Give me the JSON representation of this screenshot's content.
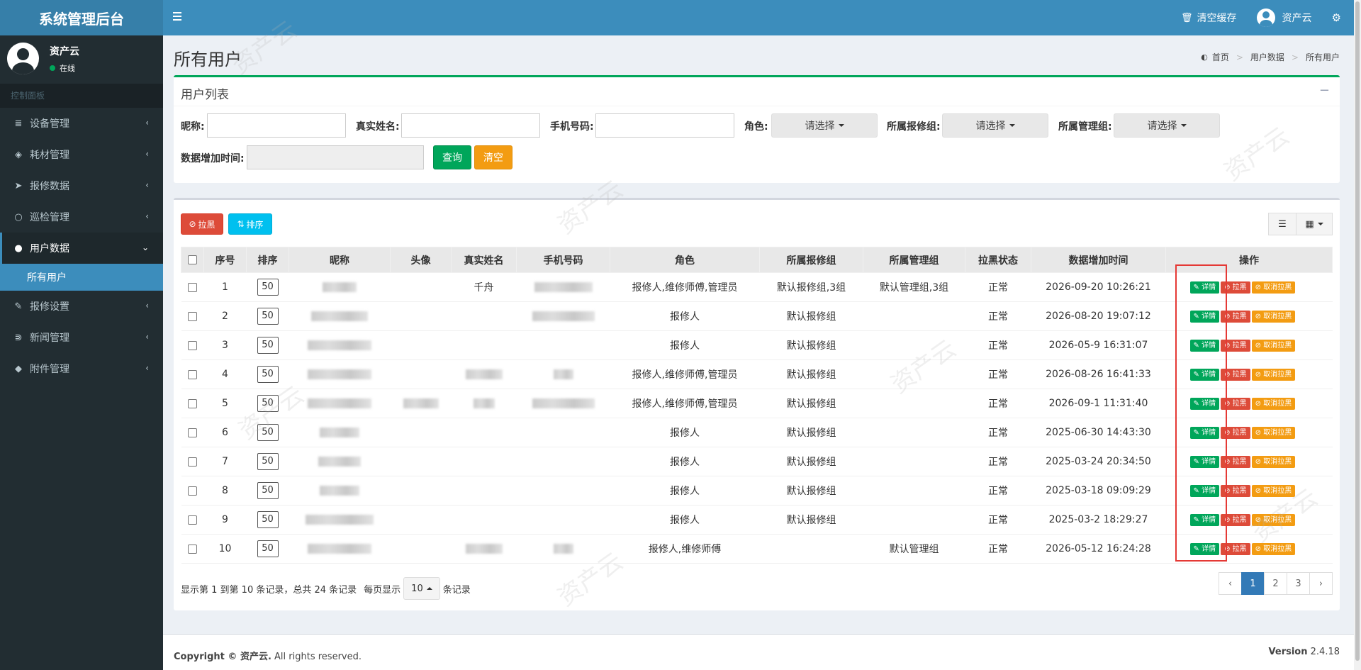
{
  "header": {
    "logo": "系统管理后台",
    "clear_cache": "清空缓存",
    "user": "资产云"
  },
  "sidebar": {
    "user": "资产云",
    "status": "在线",
    "section": "控制面板",
    "items": [
      {
        "label": "设备管理",
        "icon": "database-icon"
      },
      {
        "label": "耗材管理",
        "icon": "cube-icon"
      },
      {
        "label": "报修数据",
        "icon": "paper-plane-icon"
      },
      {
        "label": "巡检管理",
        "icon": "circle-icon"
      },
      {
        "label": "用户数据",
        "icon": "user-icon"
      },
      {
        "label": "报修设置",
        "icon": "wrench-icon"
      },
      {
        "label": "新闻管理",
        "icon": "rss-icon"
      },
      {
        "label": "附件管理",
        "icon": "tag-icon"
      }
    ],
    "sub_item": "所有用户"
  },
  "page": {
    "title": "所有用户",
    "breadcrumb": [
      "首页",
      "用户数据",
      "所有用户"
    ]
  },
  "search": {
    "title": "用户列表",
    "nickname_label": "昵称:",
    "realname_label": "真实姓名:",
    "phone_label": "手机号码:",
    "role_label": "角色:",
    "repair_group_label": "所属报修组:",
    "manage_group_label": "所属管理组:",
    "select_placeholder": "请选择",
    "date_label": "数据增加时间:",
    "query_button": "查询",
    "clear_button": "清空"
  },
  "toolbar": {
    "blacklist": "拉黑",
    "sort": "排序"
  },
  "table": {
    "headers": [
      "序号",
      "排序",
      "昵称",
      "头像",
      "真实姓名",
      "手机号码",
      "角色",
      "所属报修组",
      "所属管理组",
      "拉黑状态",
      "数据增加时间",
      "操作"
    ],
    "rows": [
      {
        "no": "1",
        "sort": "50",
        "realname": "千舟",
        "role": "报修人,维修师傅,管理员",
        "repair": "默认报修组,3组",
        "manage": "默认管理组,3组",
        "status": "正常",
        "time": "2026-09-20 10:26:21"
      },
      {
        "no": "2",
        "sort": "50",
        "realname": "",
        "role": "报修人",
        "repair": "默认报修组",
        "manage": "",
        "status": "正常",
        "time": "2026-08-20 19:07:12"
      },
      {
        "no": "3",
        "sort": "50",
        "realname": "",
        "role": "报修人",
        "repair": "默认报修组",
        "manage": "",
        "status": "正常",
        "time": "2026-05-9 16:31:07"
      },
      {
        "no": "4",
        "sort": "50",
        "realname": "",
        "role": "报修人,维修师傅,管理员",
        "repair": "默认报修组",
        "manage": "",
        "status": "正常",
        "time": "2026-08-26 16:41:33"
      },
      {
        "no": "5",
        "sort": "50",
        "realname": "",
        "role": "报修人,维修师傅,管理员",
        "repair": "默认报修组",
        "manage": "",
        "status": "正常",
        "time": "2026-09-1 11:31:40"
      },
      {
        "no": "6",
        "sort": "50",
        "realname": "",
        "role": "报修人",
        "repair": "默认报修组",
        "manage": "",
        "status": "正常",
        "time": "2025-06-30 14:43:30"
      },
      {
        "no": "7",
        "sort": "50",
        "realname": "",
        "role": "报修人",
        "repair": "默认报修组",
        "manage": "",
        "status": "正常",
        "time": "2025-03-24 20:34:50"
      },
      {
        "no": "8",
        "sort": "50",
        "realname": "",
        "role": "报修人",
        "repair": "默认报修组",
        "manage": "",
        "status": "正常",
        "time": "2025-03-18 09:09:29"
      },
      {
        "no": "9",
        "sort": "50",
        "realname": "",
        "role": "报修人",
        "repair": "默认报修组",
        "manage": "",
        "status": "正常",
        "time": "2025-03-2 18:29:27"
      },
      {
        "no": "10",
        "sort": "50",
        "realname": "",
        "role": "报修人,维修师傅",
        "repair": "",
        "manage": "默认管理组",
        "status": "正常",
        "time": "2026-05-12 16:24:28"
      }
    ],
    "actions": {
      "detail": "详情",
      "blacklist": "拉黑",
      "unblacklist": "取消拉黑"
    }
  },
  "pager": {
    "info": "显示第 1 到第 10 条记录，总共 24 条记录",
    "per_page_label": "每页显示",
    "per_page": "10",
    "per_page_suffix": "条记录",
    "pages": [
      "1",
      "2",
      "3"
    ],
    "prev": "‹",
    "next": "›"
  },
  "footer": {
    "copyright_prefix": "Copyright © ",
    "copyright_name": "资产云.",
    "copyright_suffix": " All rights reserved.",
    "version_label": "Version",
    "version": "2.4.18"
  },
  "watermark": "资产云"
}
